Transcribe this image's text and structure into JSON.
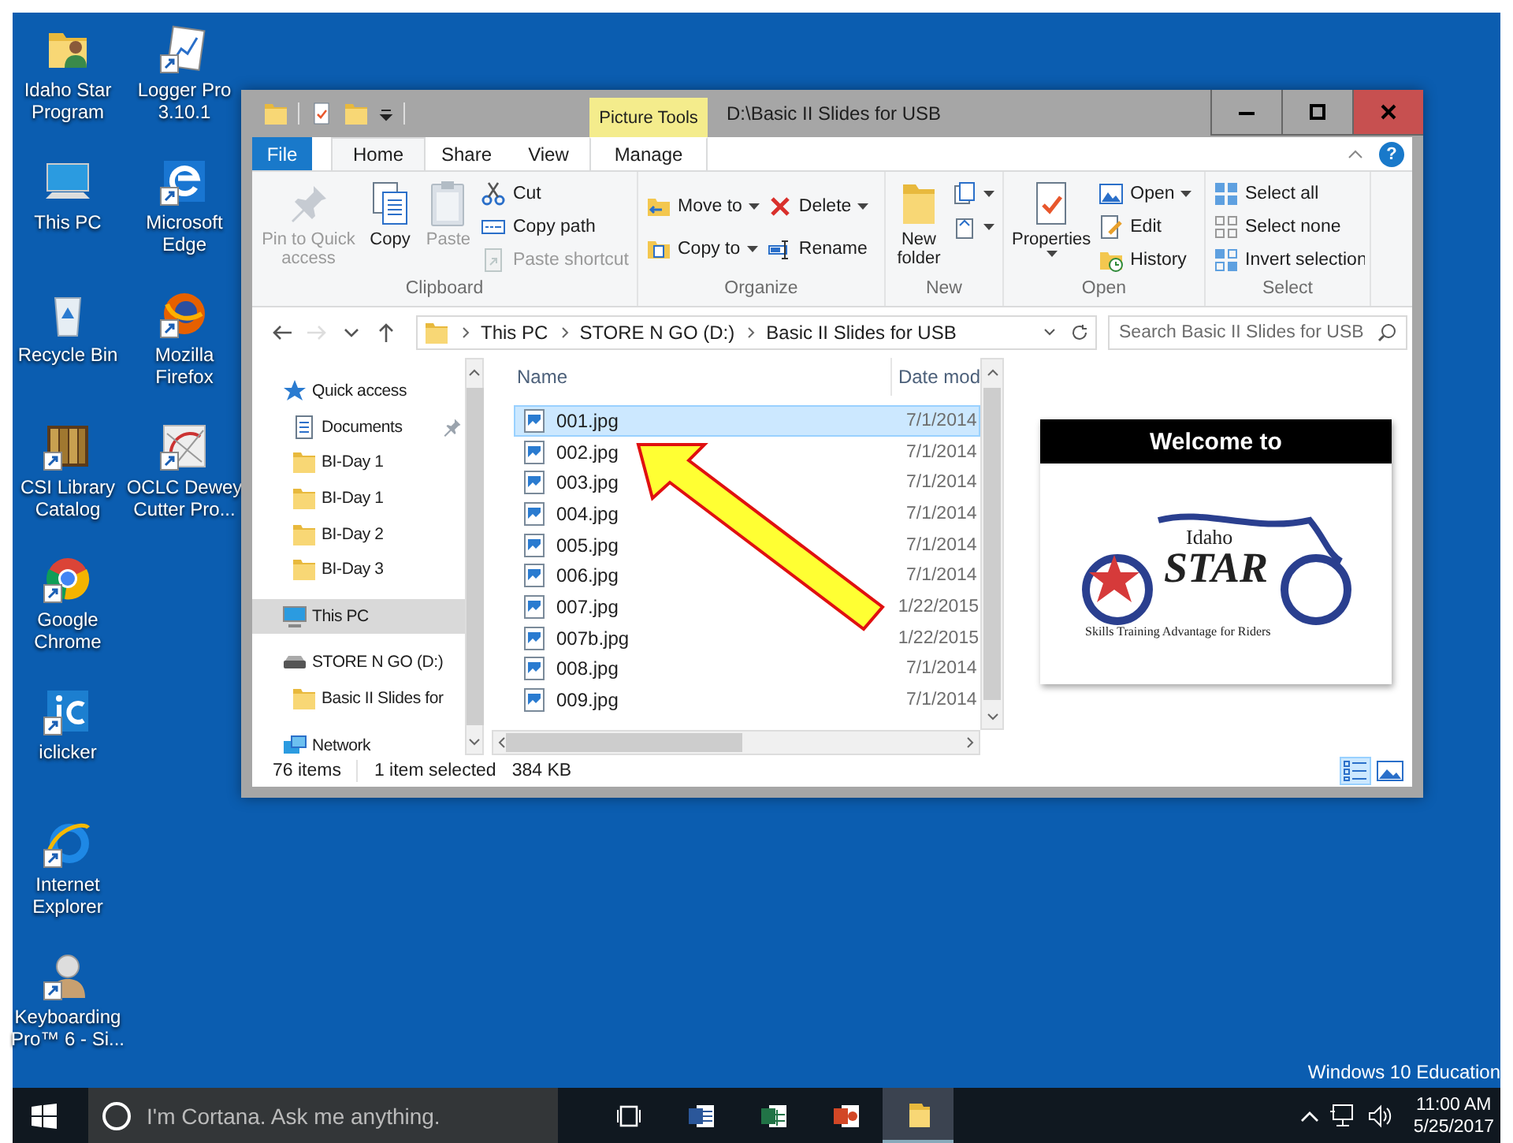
{
  "desktop": {
    "columns": [
      [
        {
          "label": "Idaho Star Program"
        },
        {
          "label": "This PC"
        },
        {
          "label": "Recycle Bin"
        },
        {
          "label": "CSI Library Catalog"
        },
        {
          "label": "Google Chrome"
        },
        {
          "label": "iclicker"
        },
        {
          "label": "Internet Explorer"
        },
        {
          "label": "Keyboarding Pro™ 6 - Si..."
        }
      ],
      [
        {
          "label": "Logger Pro 3.10.1"
        },
        {
          "label": "Microsoft Edge"
        },
        {
          "label": "Mozilla Firefox"
        },
        {
          "label": "OCLC Dewey Cutter Pro..."
        }
      ]
    ],
    "edition": "Windows 10 Education"
  },
  "window": {
    "title": "D:\\Basic II Slides for USB",
    "context_label": "Picture Tools"
  },
  "ribbon": {
    "tabs": [
      {
        "label": "File",
        "kind": "file",
        "selected": false
      },
      {
        "label": "Home",
        "kind": "tab",
        "selected": true
      },
      {
        "label": "Share",
        "kind": "tab",
        "selected": false
      },
      {
        "label": "View",
        "kind": "tab",
        "selected": false
      },
      {
        "label": "Manage",
        "kind": "context",
        "selected": false
      }
    ],
    "help": "?",
    "groups": [
      {
        "label": "Clipboard",
        "items": [
          {
            "kind": "large",
            "label": "Pin to Quick access",
            "disabled": true,
            "dropdown": false
          },
          {
            "kind": "large",
            "label": "Copy",
            "disabled": false,
            "dropdown": false
          },
          {
            "kind": "large",
            "label": "Paste",
            "disabled": true,
            "dropdown": false
          },
          {
            "kind": "small",
            "label": "Cut",
            "disabled": false,
            "dropdown": false
          },
          {
            "kind": "small",
            "label": "Copy path",
            "disabled": false,
            "dropdown": false
          },
          {
            "kind": "small",
            "label": "Paste shortcut",
            "disabled": true,
            "dropdown": false
          }
        ]
      },
      {
        "label": "Organize",
        "items": [
          {
            "kind": "small",
            "label": "Move to",
            "disabled": false,
            "dropdown": true
          },
          {
            "kind": "small",
            "label": "Copy to",
            "disabled": false,
            "dropdown": true
          },
          {
            "kind": "small",
            "label": "Delete",
            "disabled": false,
            "dropdown": true
          },
          {
            "kind": "small",
            "label": "Rename",
            "disabled": false,
            "dropdown": false
          }
        ]
      },
      {
        "label": "New",
        "items": [
          {
            "kind": "large",
            "label": "New folder",
            "disabled": false,
            "dropdown": false
          },
          {
            "kind": "icon",
            "disabled": false,
            "dropdown": true
          },
          {
            "kind": "icon",
            "disabled": false,
            "dropdown": true
          }
        ]
      },
      {
        "label": "Open",
        "items": [
          {
            "kind": "large",
            "label": "Properties",
            "disabled": false,
            "dropdown": true
          },
          {
            "kind": "small",
            "label": "Open",
            "disabled": false,
            "dropdown": true
          },
          {
            "kind": "small",
            "label": "Edit",
            "disabled": false,
            "dropdown": false
          },
          {
            "kind": "small",
            "label": "History",
            "disabled": false,
            "dropdown": false
          }
        ]
      },
      {
        "label": "Select",
        "items": [
          {
            "kind": "small",
            "label": "Select all",
            "disabled": false,
            "dropdown": false
          },
          {
            "kind": "small",
            "label": "Select none",
            "disabled": false,
            "dropdown": false
          },
          {
            "kind": "small",
            "label": "Invert selection",
            "disabled": false,
            "dropdown": false
          }
        ]
      }
    ]
  },
  "address": {
    "buttons": [
      {
        "kind": "back",
        "disabled": false
      },
      {
        "kind": "forward",
        "disabled": true
      },
      {
        "kind": "recent",
        "disabled": false
      },
      {
        "kind": "up",
        "disabled": false
      }
    ],
    "breadcrumb": [
      "This PC",
      "STORE N GO (D:)",
      "Basic II Slides for USB"
    ],
    "search": {
      "placeholder": "Search Basic II Slides for USB"
    }
  },
  "nav_pane": {
    "items": [
      {
        "label": "Quick access",
        "kind": "quick_access",
        "selected": false,
        "children": [
          {
            "label": "Documents",
            "kind": "documents",
            "pinned": true,
            "selected": false
          },
          {
            "label": "BI-Day 1",
            "kind": "folder",
            "pinned": false,
            "selected": false
          },
          {
            "label": "BI-Day 1",
            "kind": "folder",
            "pinned": false,
            "selected": false
          },
          {
            "label": "BI-Day 2",
            "kind": "folder",
            "pinned": false,
            "selected": false
          },
          {
            "label": "BI-Day 3",
            "kind": "folder",
            "pinned": false,
            "selected": false
          }
        ]
      },
      {
        "label": "This PC",
        "kind": "pc",
        "selected": true
      },
      {
        "label": "STORE N GO (D:)",
        "kind": "drive",
        "selected": false,
        "children": [
          {
            "label": "Basic II Slides for",
            "kind": "folder",
            "pinned": false,
            "selected": false
          }
        ]
      },
      {
        "label": "Network",
        "kind": "network",
        "selected": false
      }
    ]
  },
  "files": {
    "columns": [
      "Name",
      "Date mod"
    ],
    "rows": [
      {
        "name": "001.jpg",
        "date": "7/1/2014",
        "selected": true
      },
      {
        "name": "002.jpg",
        "date": "7/1/2014",
        "selected": false
      },
      {
        "name": "003.jpg",
        "date": "7/1/2014",
        "selected": false
      },
      {
        "name": "004.jpg",
        "date": "7/1/2014",
        "selected": false
      },
      {
        "name": "005.jpg",
        "date": "7/1/2014",
        "selected": false
      },
      {
        "name": "006.jpg",
        "date": "7/1/2014",
        "selected": false
      },
      {
        "name": "007.jpg",
        "date": "1/22/2015",
        "selected": false
      },
      {
        "name": "007b.jpg",
        "date": "1/22/2015",
        "selected": false
      },
      {
        "name": "008.jpg",
        "date": "7/1/2014",
        "selected": false
      },
      {
        "name": "009.jpg",
        "date": "7/1/2014",
        "selected": false
      }
    ]
  },
  "preview": {
    "heading": "Welcome to",
    "logo_small": "Idaho",
    "logo_big": "STAR",
    "tagline": "Skills Training Advantage for Riders"
  },
  "status_bar": {
    "count": "76 items",
    "selection": "1 item selected",
    "size": "384 KB",
    "views": [
      {
        "kind": "details",
        "selected": true
      },
      {
        "kind": "large_icons",
        "selected": false
      }
    ]
  },
  "taskbar": {
    "search": {
      "placeholder": "I'm Cortana. Ask me anything."
    },
    "apps": [
      {
        "kind": "task_view",
        "active": false
      },
      {
        "kind": "word",
        "active": false
      },
      {
        "kind": "excel",
        "active": false
      },
      {
        "kind": "powerpoint",
        "active": false
      },
      {
        "kind": "explorer",
        "active": true
      }
    ],
    "clock": {
      "time": "11:00 AM",
      "date": "5/25/2017"
    }
  }
}
